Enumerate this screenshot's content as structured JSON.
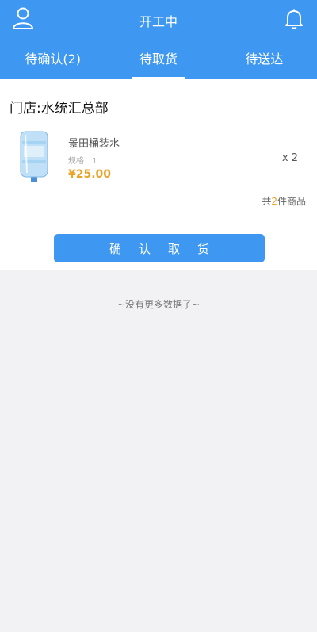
{
  "header": {
    "title": "开工中",
    "user_icon": "user-icon",
    "bell_icon": "bell-icon",
    "color": "#3e97f0"
  },
  "tabs": [
    {
      "label": "待确认(2)",
      "active": false
    },
    {
      "label": "待取货",
      "active": true
    },
    {
      "label": "待送达",
      "active": false
    }
  ],
  "order": {
    "store": "门店:水统汇总部",
    "product": {
      "name": "景田桶装水",
      "spec": "规格：1",
      "price": "¥25.00",
      "qty": "x 2"
    },
    "total_prefix": "共",
    "total_count": "2",
    "total_suffix": "件商品",
    "confirm_label": "确认取货"
  },
  "footer_note": "~没有更多数据了~"
}
